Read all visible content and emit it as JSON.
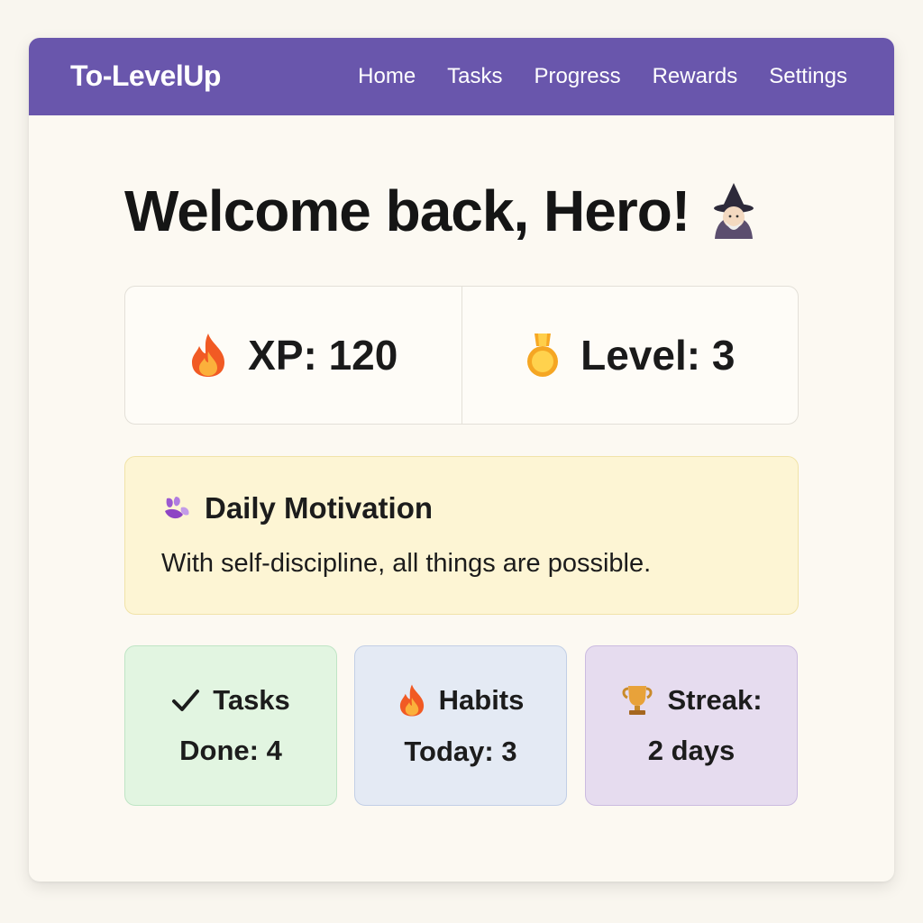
{
  "nav": {
    "brand": "To-LevelUp",
    "links": [
      "Home",
      "Tasks",
      "Progress",
      "Rewards",
      "Settings"
    ]
  },
  "welcome": {
    "title": "Welcome back, Hero!",
    "icon": "wizard-icon"
  },
  "stats": {
    "xp_label": "XP: 120",
    "xp_icon": "fire-icon",
    "level_label": "Level: 3",
    "level_icon": "medal-icon"
  },
  "motivation": {
    "title": "Daily Motivation",
    "icon": "sparkle-icon",
    "quote": "With self-discipline, all things are possible."
  },
  "cards": {
    "tasks": {
      "line1": "Tasks",
      "line2": "Done: 4",
      "icon": "checkmark-icon"
    },
    "habits": {
      "line1": "Habits",
      "line2": "Today: 3",
      "icon": "fire-icon"
    },
    "streak": {
      "line1": "Streak:",
      "line2": "2 days",
      "icon": "trophy-icon"
    }
  },
  "colors": {
    "nav": "#6956ac",
    "background": "#f9f6ef",
    "motivation_bg": "#fdf5d4",
    "tasks_bg": "#e2f5e1",
    "habits_bg": "#e4eaf4",
    "streak_bg": "#e6dcef"
  }
}
